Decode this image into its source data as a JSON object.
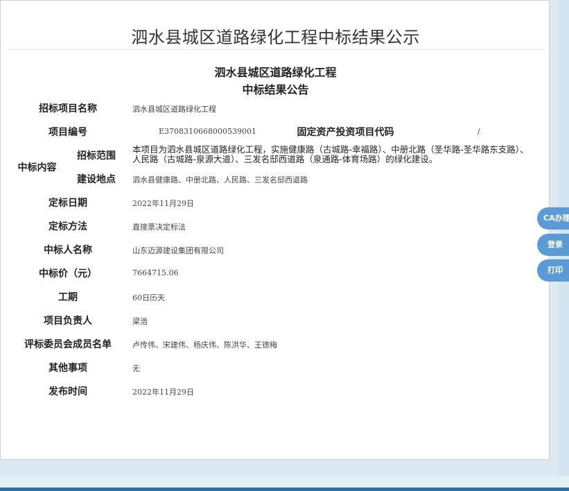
{
  "page": {
    "title": "泗水县城区道路绿化工程中标结果公示"
  },
  "document": {
    "title_line1": "泗水县城区道路绿化工程",
    "title_line2": "中标结果公告"
  },
  "fields": {
    "project_name_label": "招标项目名称",
    "project_name_value": "泗水县城区道路绿化工程",
    "project_code_label": "项目编号",
    "project_code_value": "E3708310668000539001",
    "fixed_asset_code_label": "固定资产投资项目代码",
    "fixed_asset_code_value": "/",
    "content_label": "中标内容",
    "scope_label": "招标范围",
    "scope_value": "本项目为泗水县城区道路绿化工程，实施健康路（古城路-幸福路）、中册北路（圣华路-圣华路东支路）、人民路（古城路-泉源大道）、三发名邸西道路（泉通路-体育场路）的绿化建设。",
    "site_label": "建设地点",
    "site_value": "泗水县健康路、中册北路、人民路、三发名邸西道路",
    "award_date_label": "定标日期",
    "award_date_value": "2022年11月29日",
    "award_method_label": "定标方法",
    "award_method_value": "直接票决定标法",
    "winner_label": "中标人名称",
    "winner_value": "山东迈源建设集团有限公司",
    "price_label": "中标价（元）",
    "price_value": "7664715.06",
    "duration_label": "工期",
    "duration_value": "60日历天",
    "manager_label": "项目负责人",
    "manager_value": "梁浩",
    "committee_label": "评标委员会成员名单",
    "committee_value": "卢传伟、宋建伟、杨庆伟、陈洪华、王德梅",
    "other_label": "其他事项",
    "other_value": "无",
    "publish_time_label": "发布时间",
    "publish_time_value": "2022年11月29日"
  },
  "side_buttons": {
    "ca": "CA办理",
    "login": "登录",
    "print": "打印"
  },
  "colors": {
    "accent": "#5b9bd5",
    "bottom_bar": "#2f6fa8",
    "background": "#dde9f2"
  }
}
